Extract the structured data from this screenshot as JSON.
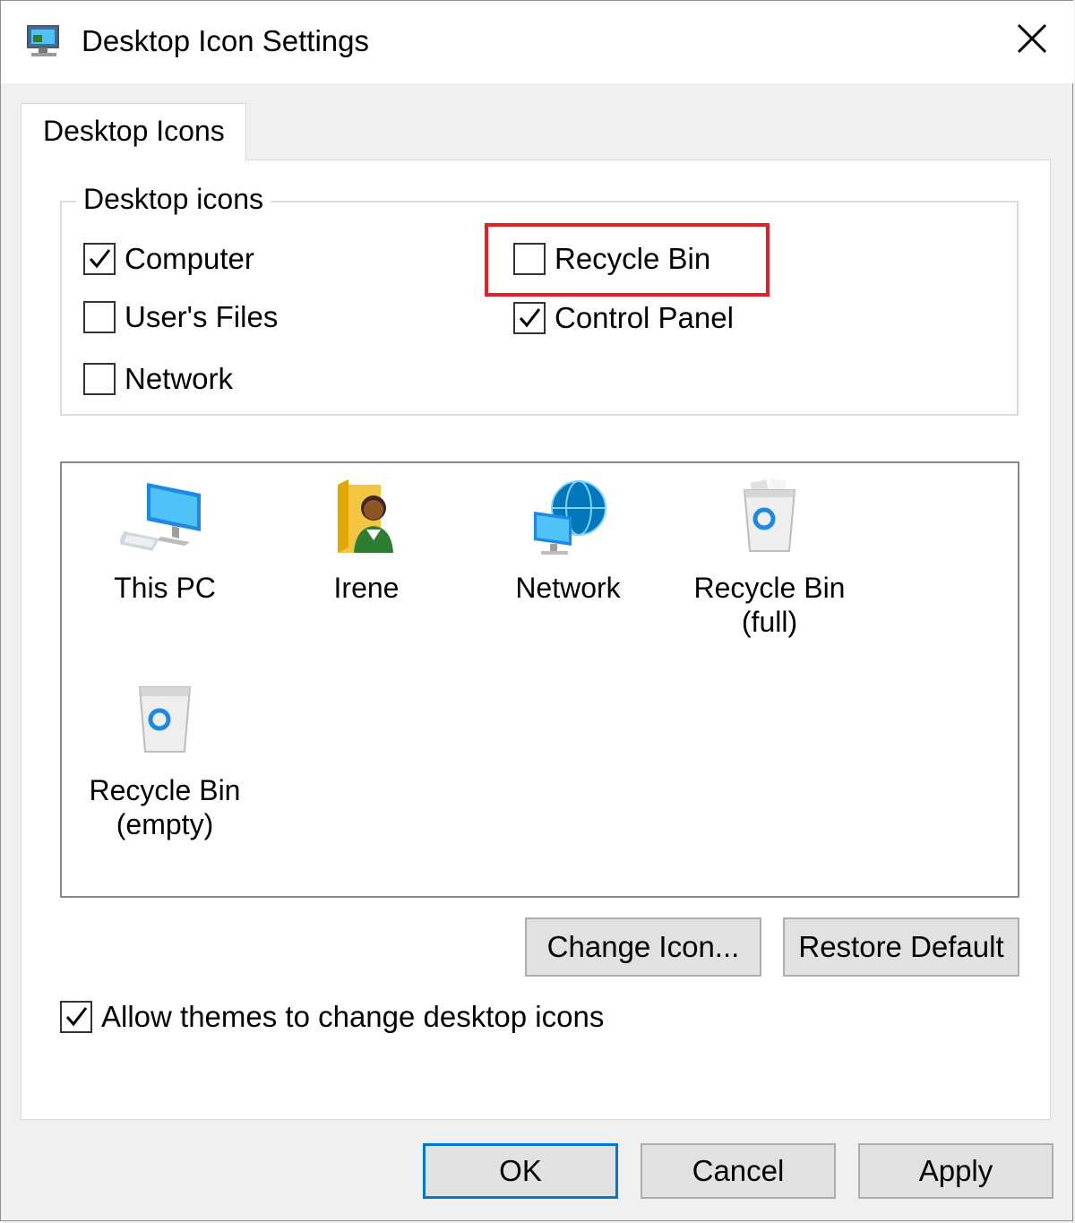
{
  "window": {
    "title": "Desktop Icon Settings",
    "app_icon": "desktop-settings-icon",
    "close_icon": "close-icon"
  },
  "tabs": [
    {
      "label": "Desktop Icons",
      "active": true
    }
  ],
  "desktop_icons_group": {
    "legend": "Desktop icons",
    "checkboxes": [
      {
        "label": "Computer",
        "checked": true
      },
      {
        "label": "User's Files",
        "checked": false
      },
      {
        "label": "Network",
        "checked": false
      },
      {
        "label": "Recycle Bin",
        "checked": false,
        "highlighted": true
      },
      {
        "label": "Control Panel",
        "checked": true
      }
    ]
  },
  "icon_preview": {
    "items": [
      {
        "caption": "This PC",
        "icon": "this-pc-icon"
      },
      {
        "caption": "Irene",
        "icon": "user-folder-icon"
      },
      {
        "caption": "Network",
        "icon": "network-icon"
      },
      {
        "caption": "Recycle Bin\n(full)",
        "icon": "recycle-bin-full-icon"
      },
      {
        "caption": "Recycle Bin\n(empty)",
        "icon": "recycle-bin-empty-icon"
      }
    ]
  },
  "icon_buttons": {
    "change_icon": "Change Icon...",
    "restore_default": "Restore Default"
  },
  "allow_themes": {
    "label": "Allow themes to change desktop icons",
    "checked": true
  },
  "footer_buttons": {
    "ok": "OK",
    "cancel": "Cancel",
    "apply": "Apply"
  },
  "colors": {
    "highlight": "#e4202a",
    "default_button_border": "#0078d7"
  }
}
